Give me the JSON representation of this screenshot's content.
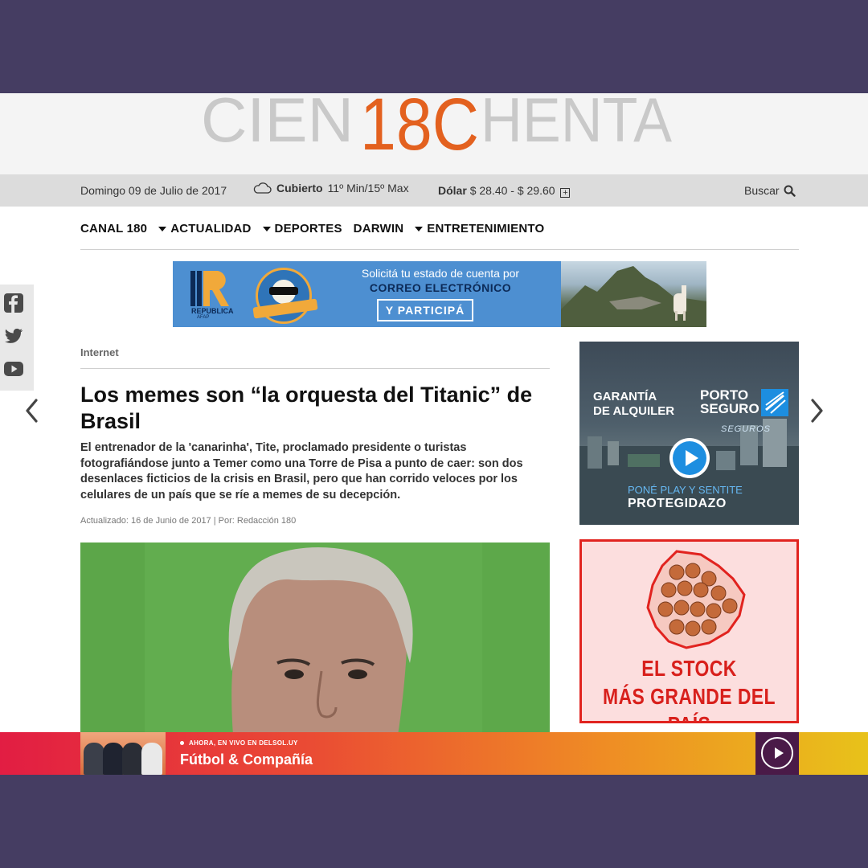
{
  "site": {
    "logo_text_left": "CIEN",
    "logo_text_mid": "18C",
    "logo_text_right": "HENTA",
    "logo_accent_color": "#e3611f"
  },
  "infobar": {
    "date": "Domingo 09 de Julio de 2017",
    "weather_label": "Cubierto",
    "weather_temp": "11º Min/15º Max",
    "dolar_label": "Dólar",
    "dolar_value": "$ 28.40 - $ 29.60",
    "search_label": "Buscar"
  },
  "nav": {
    "items": [
      {
        "label": "CANAL 180",
        "dropdown": false
      },
      {
        "label": "ACTUALIDAD",
        "dropdown": true
      },
      {
        "label": "DEPORTES",
        "dropdown": true
      },
      {
        "label": "DARWIN",
        "dropdown": false
      },
      {
        "label": "ENTRETENIMIENTO",
        "dropdown": true
      }
    ]
  },
  "banner_top": {
    "brand": "REPUBLICA",
    "brand_sub": "AFAP",
    "line1": "Solicitá tu estado de cuenta por",
    "line2": "CORREO ELECTRÓNICO",
    "cta": "Y PARTICIPÁ"
  },
  "article": {
    "section": "Internet",
    "headline": "Los memes son “la orquesta del Titanic” de Brasil",
    "lede": "El entrenador de la 'canarinha', Tite, proclamado presidente o turistas fotografiándose junto a Temer como una Torre de Pisa a punto de caer: son dos desenlaces ficticios de la crisis en Brasil, pero que han corrido veloces por los celulares de un país que se ríe a memes de su decepción.",
    "meta": "Actualizado: 16 de Junio de 2017 | Por: Redacción 180"
  },
  "ad_porto": {
    "title_line1": "GARANTÍA",
    "title_line2": "DE ALQUILER",
    "brand_line1": "PORTO",
    "brand_line2": "SEGURO",
    "brand_sub": "SEGUROS",
    "tagline1": "PONÉ PLAY Y SENTITE",
    "tagline2": "PROTEGIDAZO"
  },
  "ad_stock": {
    "line1": "EL STOCK",
    "line2": "MÁS GRANDE DEL PAÍS"
  },
  "livebar": {
    "kicker": "AHORA, EN VIVO EN DELSOL.UY",
    "title": "Fútbol & Compañía"
  }
}
